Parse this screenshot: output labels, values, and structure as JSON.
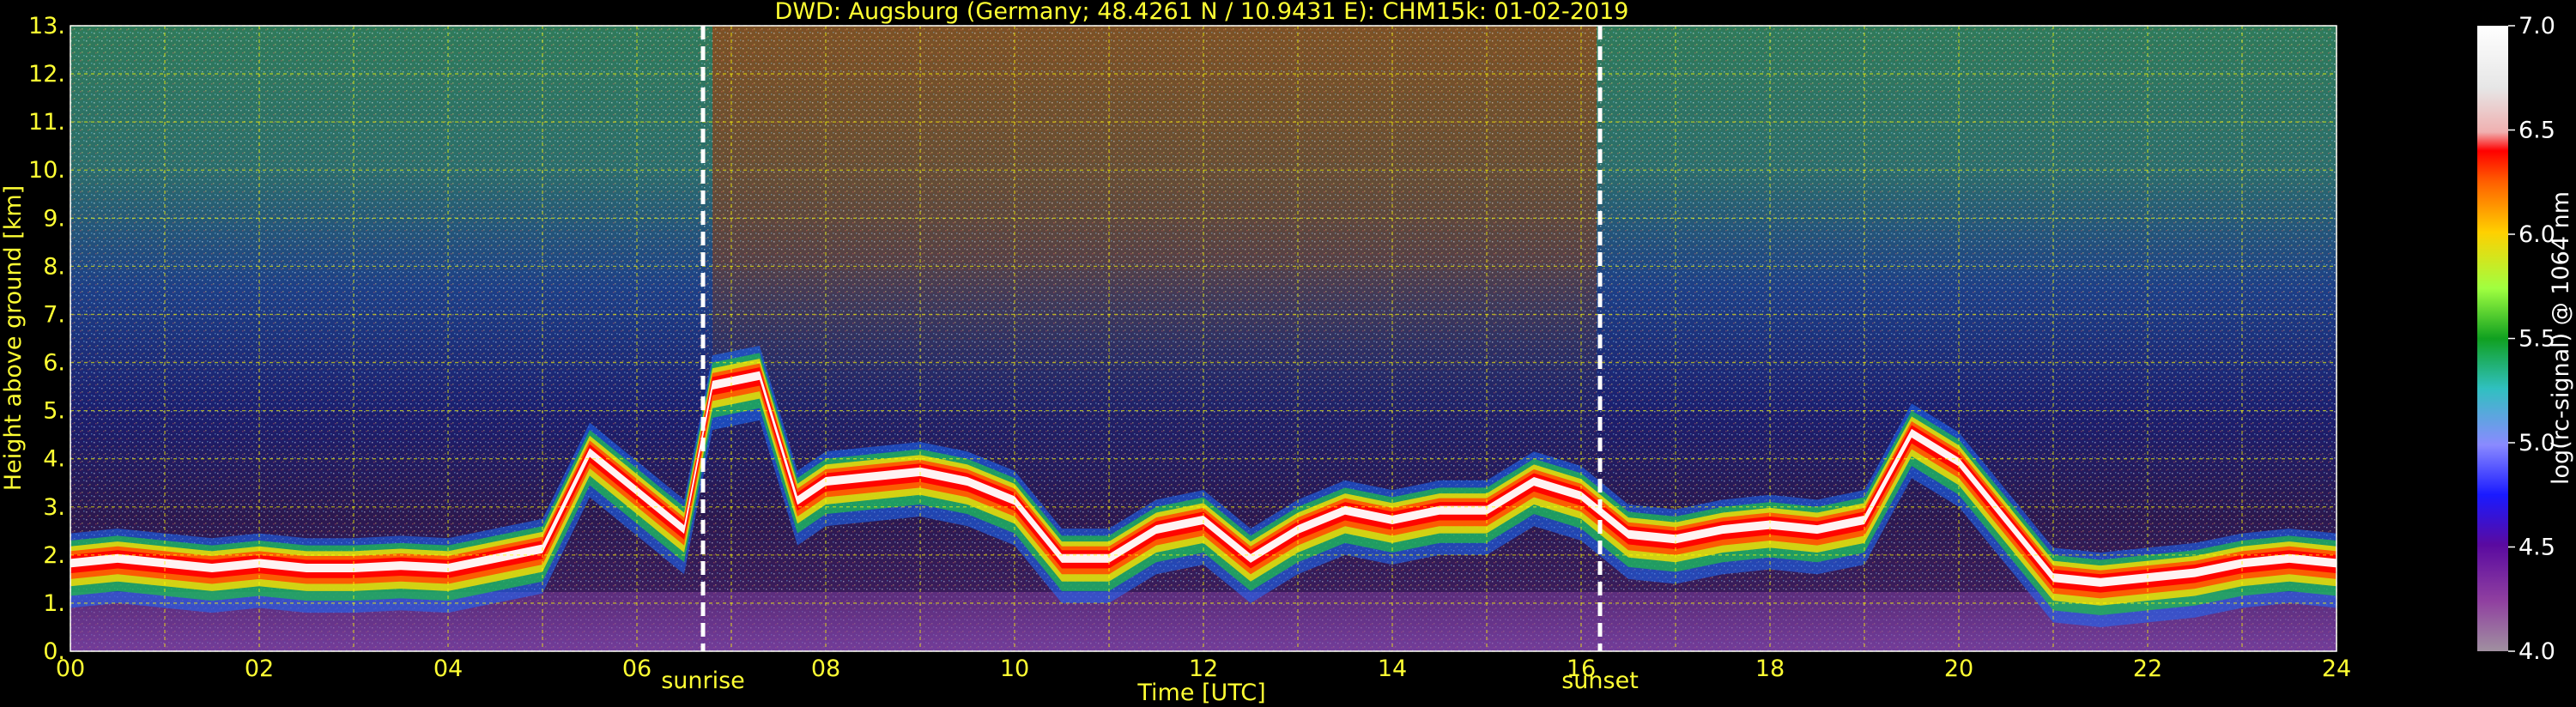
{
  "chart_data": {
    "type": "heatmap",
    "title": "DWD: Augsburg (Germany; 48.4261 N / 10.9431 E):    CHM15k: 01-02-2019",
    "xlabel": "Time [UTC]",
    "ylabel": "Height above ground [km]",
    "xlim": [
      0,
      24
    ],
    "ylim": [
      0,
      13
    ],
    "x_ticks": [
      "00",
      "02",
      "04",
      "06",
      "08",
      "10",
      "12",
      "14",
      "16",
      "18",
      "20",
      "22",
      "24"
    ],
    "y_ticks": [
      "0.",
      "1.",
      "2.",
      "3.",
      "4.",
      "5.",
      "6.",
      "7.",
      "8.",
      "9.",
      "10.",
      "11.",
      "12.",
      "13."
    ],
    "grid": true,
    "grid_color": "#ffff00",
    "markers": [
      {
        "label": "sunrise",
        "x": 6.7
      },
      {
        "label": "sunset",
        "x": 16.2
      }
    ],
    "colorbar": {
      "label": "log(rc-signal) @ 1064 nm",
      "range": [
        4.0,
        7.0
      ],
      "ticks": [
        "4.0",
        "4.5",
        "5.0",
        "5.5",
        "6.0",
        "6.5",
        "7.0"
      ]
    },
    "cloud_layer_top_km": [
      [
        0.0,
        1.9
      ],
      [
        0.5,
        2.0
      ],
      [
        1.0,
        1.9
      ],
      [
        1.5,
        1.8
      ],
      [
        2.0,
        1.9
      ],
      [
        2.5,
        1.8
      ],
      [
        3.0,
        1.8
      ],
      [
        3.5,
        1.85
      ],
      [
        4.0,
        1.8
      ],
      [
        4.5,
        2.0
      ],
      [
        5.0,
        2.2
      ],
      [
        5.5,
        4.2
      ],
      [
        6.0,
        3.4
      ],
      [
        6.5,
        2.6
      ],
      [
        6.8,
        5.6
      ],
      [
        7.3,
        5.8
      ],
      [
        7.7,
        3.2
      ],
      [
        8.0,
        3.6
      ],
      [
        8.5,
        3.7
      ],
      [
        9.0,
        3.8
      ],
      [
        9.5,
        3.6
      ],
      [
        10.0,
        3.2
      ],
      [
        10.5,
        2.0
      ],
      [
        11.0,
        2.0
      ],
      [
        11.5,
        2.6
      ],
      [
        12.0,
        2.8
      ],
      [
        12.5,
        2.0
      ],
      [
        13.0,
        2.6
      ],
      [
        13.5,
        3.0
      ],
      [
        14.0,
        2.8
      ],
      [
        14.5,
        3.0
      ],
      [
        15.0,
        3.0
      ],
      [
        15.5,
        3.6
      ],
      [
        16.0,
        3.3
      ],
      [
        16.5,
        2.5
      ],
      [
        17.0,
        2.4
      ],
      [
        17.5,
        2.6
      ],
      [
        18.0,
        2.7
      ],
      [
        18.5,
        2.6
      ],
      [
        19.0,
        2.8
      ],
      [
        19.5,
        4.6
      ],
      [
        20.0,
        4.0
      ],
      [
        20.5,
        2.8
      ],
      [
        21.0,
        1.6
      ],
      [
        21.5,
        1.5
      ],
      [
        22.0,
        1.6
      ],
      [
        22.5,
        1.7
      ],
      [
        23.0,
        1.9
      ],
      [
        23.5,
        2.0
      ],
      [
        24.0,
        1.9
      ]
    ]
  }
}
